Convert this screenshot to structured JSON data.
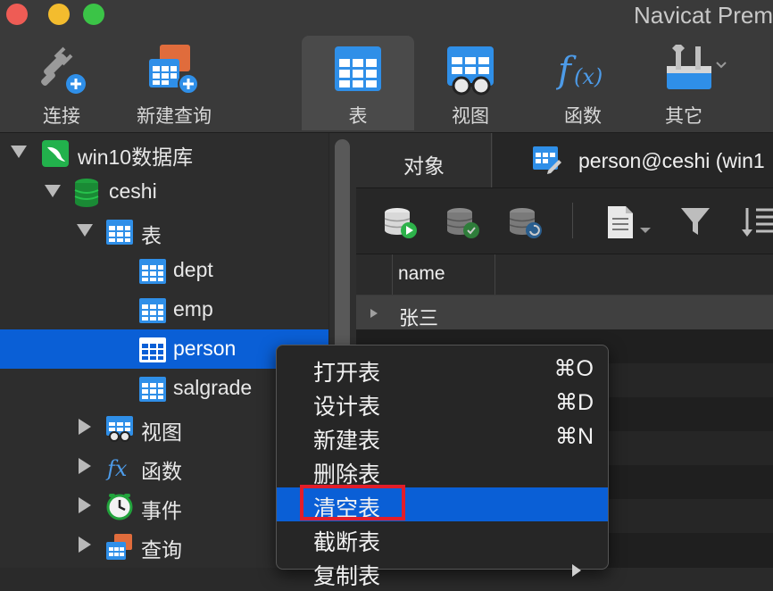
{
  "window": {
    "title": "Navicat Prem"
  },
  "toolbar": {
    "items": [
      {
        "label": "连接",
        "icon": "plug-add-icon"
      },
      {
        "label": "新建查询",
        "icon": "new-query-icon"
      },
      {
        "label": "表",
        "icon": "table-icon"
      },
      {
        "label": "视图",
        "icon": "view-icon"
      },
      {
        "label": "函数",
        "icon": "function-icon"
      },
      {
        "label": "其它",
        "icon": "tools-icon"
      }
    ]
  },
  "sidebar": {
    "connection": "win10数据库",
    "database": "ceshi",
    "tables_group": "表",
    "tables": [
      "dept",
      "emp",
      "person",
      "salgrade"
    ],
    "selected_table": "person",
    "groups": [
      {
        "label": "视图",
        "icon": "view-icon"
      },
      {
        "label": "函数",
        "icon": "function-icon"
      },
      {
        "label": "事件",
        "icon": "clock-icon"
      },
      {
        "label": "查询",
        "icon": "query-icon"
      }
    ]
  },
  "tabs": {
    "objects": "对象",
    "person": "person@ceshi (win1"
  },
  "grid": {
    "column": "name",
    "rows": [
      "张三"
    ]
  },
  "context_menu": {
    "items": [
      {
        "label": "打开表",
        "shortcut": "⌘O"
      },
      {
        "label": "设计表",
        "shortcut": "⌘D"
      },
      {
        "label": "新建表",
        "shortcut": "⌘N"
      },
      {
        "label": "删除表",
        "shortcut": ""
      },
      {
        "label": "清空表",
        "shortcut": ""
      },
      {
        "label": "截断表",
        "shortcut": ""
      },
      {
        "label": "复制表",
        "shortcut": ""
      }
    ],
    "highlighted": "清空表"
  },
  "colors": {
    "selection": "#0a5fd6",
    "highlight_box": "#e21d2a",
    "accent_blue": "#2f8fe8"
  }
}
